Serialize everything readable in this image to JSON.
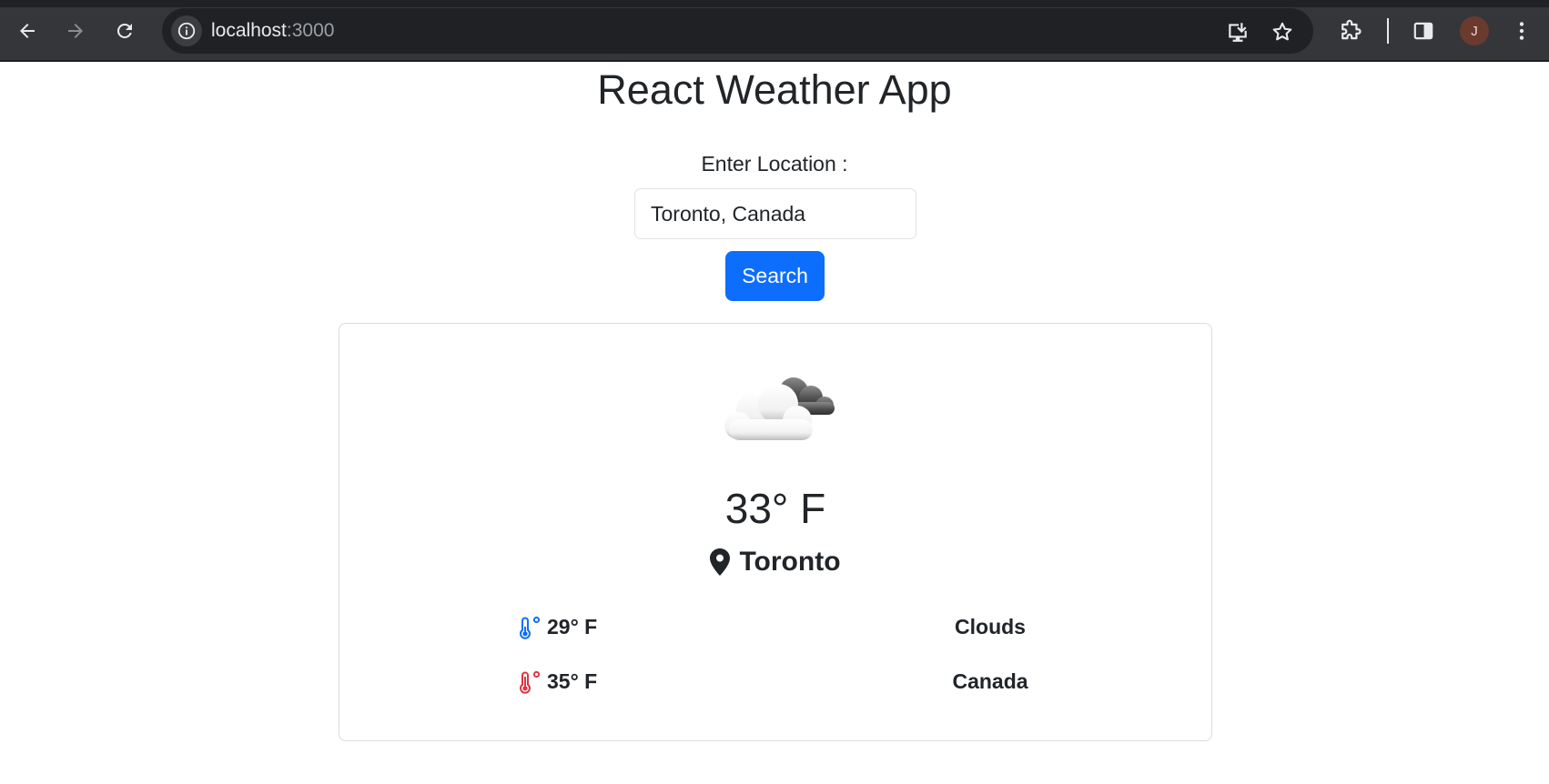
{
  "browser": {
    "url_host": "localhost",
    "url_port": ":3000",
    "profile_initial": "J"
  },
  "app": {
    "title": "React Weather App",
    "location_label": "Enter Location :",
    "location_value": "Toronto, Canada",
    "search_label": "Search"
  },
  "weather": {
    "icon": "partly-cloudy-icon",
    "temperature": "33° F",
    "city": "Toronto",
    "min_temp": "29° F",
    "max_temp": "35° F",
    "condition": "Clouds",
    "country": "Canada"
  },
  "colors": {
    "primary": "#0d6efd",
    "min_temp_icon": "#0d6efd",
    "max_temp_icon": "#dc3545"
  }
}
